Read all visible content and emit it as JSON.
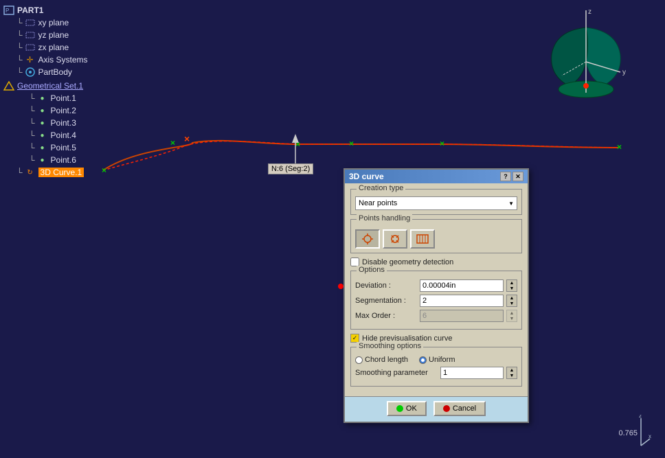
{
  "tree": {
    "items": [
      {
        "id": "part1",
        "label": "PART1",
        "indent": 0,
        "icon": "⬡",
        "underline": false,
        "active": false
      },
      {
        "id": "xy-plane",
        "label": "xy plane",
        "indent": 1,
        "icon": "▱",
        "underline": false,
        "active": false
      },
      {
        "id": "yz-plane",
        "label": "yz plane",
        "indent": 1,
        "icon": "▱",
        "underline": false,
        "active": false
      },
      {
        "id": "zx-plane",
        "label": "zx plane",
        "indent": 1,
        "icon": "▱",
        "underline": false,
        "active": false
      },
      {
        "id": "axis-systems",
        "label": "Axis Systems",
        "indent": 1,
        "icon": "✛",
        "underline": false,
        "active": false
      },
      {
        "id": "partbody",
        "label": "PartBody",
        "indent": 1,
        "icon": "⚙",
        "underline": false,
        "active": false
      },
      {
        "id": "geo-set",
        "label": "Geometrical Set.1",
        "indent": 0,
        "icon": "☆",
        "underline": true,
        "active": false
      },
      {
        "id": "point1",
        "label": "Point.1",
        "indent": 2,
        "icon": "·",
        "underline": false,
        "active": false
      },
      {
        "id": "point2",
        "label": "Point.2",
        "indent": 2,
        "icon": "·",
        "underline": false,
        "active": false
      },
      {
        "id": "point3",
        "label": "Point.3",
        "indent": 2,
        "icon": "·",
        "underline": false,
        "active": false
      },
      {
        "id": "point4",
        "label": "Point.4",
        "indent": 2,
        "icon": "·",
        "underline": false,
        "active": false
      },
      {
        "id": "point5",
        "label": "Point.5",
        "indent": 2,
        "icon": "·",
        "underline": false,
        "active": false
      },
      {
        "id": "point6",
        "label": "Point.6",
        "indent": 2,
        "icon": "·",
        "underline": false,
        "active": false
      },
      {
        "id": "curve1",
        "label": "3D Curve.1",
        "indent": 1,
        "icon": "↻",
        "underline": false,
        "active": true
      }
    ]
  },
  "dialog": {
    "title": "3D curve",
    "creation_type_label": "Creation type",
    "creation_type_value": "Near points",
    "points_handling_label": "Points handling",
    "disable_geometry_label": "Disable geometry detection",
    "options_label": "Options",
    "deviation_label": "Deviation :",
    "deviation_value": "0.00004in",
    "segmentation_label": "Segmentation :",
    "segmentation_value": "2",
    "max_order_label": "Max Order :",
    "max_order_value": "6",
    "hide_preview_label": "Hide previsualisation curve",
    "smoothing_label": "Smoothing options",
    "chord_length_label": "Chord length",
    "uniform_label": "Uniform",
    "smoothing_param_label": "Smoothing parameter",
    "smoothing_param_value": "1",
    "ok_label": "OK",
    "cancel_label": "Cancel"
  },
  "viewport": {
    "curve_label": "N:6 (Seg:2)",
    "value_display": "0.765"
  },
  "icons": {
    "help": "?",
    "close": "✕",
    "spinner_up": "▲",
    "spinner_down": "▼"
  }
}
